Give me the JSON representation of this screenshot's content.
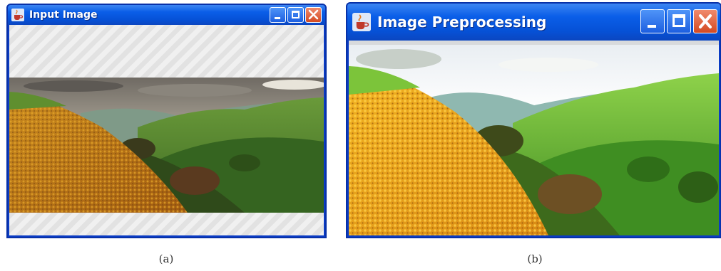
{
  "windows": [
    {
      "title": "Input Image",
      "buttons": [
        "minimize",
        "maximize",
        "close"
      ]
    },
    {
      "title": "Image Preprocessing",
      "buttons": [
        "minimize",
        "maximize",
        "close"
      ]
    }
  ],
  "captions": [
    "(a)",
    "(b)"
  ],
  "icons": {
    "app": "java-cup-icon",
    "minimize": "minimize-icon",
    "maximize": "maximize-icon",
    "close": "close-icon"
  },
  "colors": {
    "titlebar": "#0651d6",
    "close_button": "#d44a22",
    "window_border": "#0831a8"
  }
}
